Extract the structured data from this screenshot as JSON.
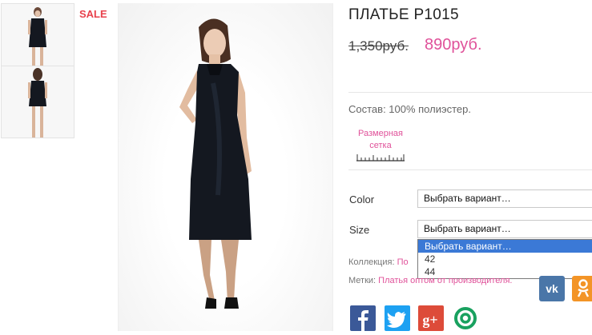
{
  "badge": {
    "sale": "SALE"
  },
  "product": {
    "title": "ПЛАТЬЕ P1015",
    "old_price": "1,350руб.",
    "new_price": "890руб.",
    "composition": "Состав: 100% полиэстер."
  },
  "size_chart": {
    "label_line1": "Размерная",
    "label_line2": "сетка"
  },
  "options": {
    "color": {
      "label": "Color",
      "value": "Выбрать вариант…"
    },
    "size": {
      "label": "Size",
      "value": "Выбрать вариант…",
      "dropdown": [
        "Выбрать вариант…",
        "42",
        "44"
      ]
    }
  },
  "meta": {
    "collection_label": "Коллекция:",
    "collection_value": "По",
    "tags_label": "Метки:",
    "tags_value": "Платья оптом от производителя."
  },
  "share_icons": {
    "vk": "vk-icon",
    "ok": "odnoklassniki-icon",
    "facebook": "facebook-icon",
    "twitter": "twitter-icon",
    "googleplus": "google-plus-icon",
    "mail": "at-sign-icon"
  },
  "colors": {
    "accent": "#e0529a",
    "sale": "#e8414c",
    "vk": "#4a76a8",
    "ok": "#f39426",
    "facebook": "#3b5998",
    "twitter": "#1da1f2",
    "googleplus": "#dd4b39",
    "mail": "#19a15f",
    "dress": "#141820"
  }
}
